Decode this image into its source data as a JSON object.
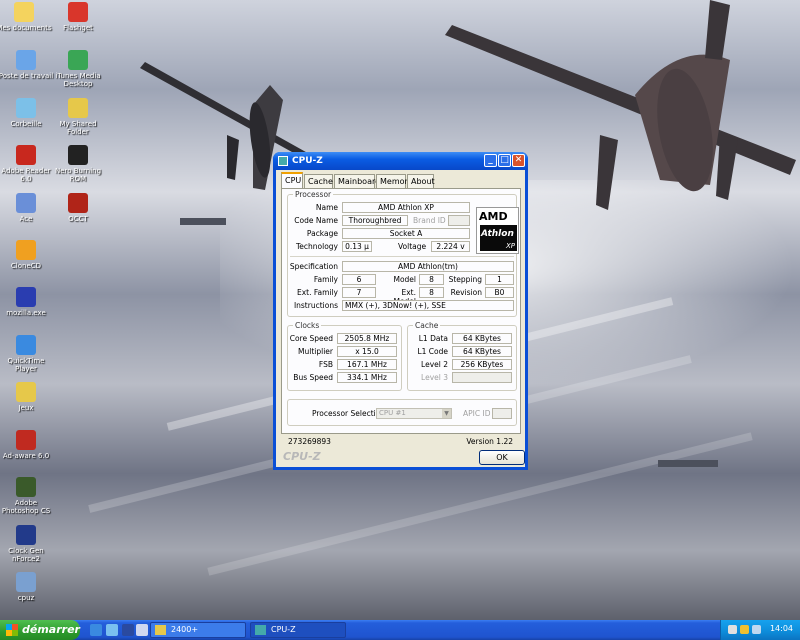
{
  "desktop": {
    "icons": [
      {
        "label": "Mes documents",
        "color": "#f4d35e"
      },
      {
        "label": "Flashget",
        "color": "#d9362b"
      },
      {
        "label": "Poste de travail",
        "color": "#6aa5e8"
      },
      {
        "label": "iTunes Media Desktop",
        "color": "#3aa655"
      },
      {
        "label": "Corbeille",
        "color": "#7cc0e8"
      },
      {
        "label": "My Shared Folder",
        "color": "#e6c84a"
      },
      {
        "label": "Adobe Reader 6.0",
        "color": "#c8281e"
      },
      {
        "label": "Nero Burning ROM",
        "color": "#222222"
      },
      {
        "label": "Ace",
        "color": "#6a8fd8"
      },
      {
        "label": "OCCT",
        "color": "#b02418"
      },
      {
        "label": "CloneCD",
        "color": "#f0a020"
      },
      {
        "label": "mozilla.exe",
        "color": "#2a3db0"
      },
      {
        "label": "QuickTime Player",
        "color": "#3a8ae0"
      },
      {
        "label": "Jeux",
        "color": "#e6c84a"
      },
      {
        "label": "Ad-aware 6.0",
        "color": "#c02a20"
      },
      {
        "label": "Adobe Photoshop CS",
        "color": "#3a5a2a"
      },
      {
        "label": "Clock Gen nForce2",
        "color": "#223a8a"
      },
      {
        "label": "cpuz",
        "color": "#7aa0d0"
      }
    ]
  },
  "window": {
    "title": "CPU-Z",
    "icon": "cpuz-app-icon",
    "tabs": [
      "CPU",
      "Cache",
      "Mainboard",
      "Memory",
      "About"
    ],
    "active_tab": "CPU",
    "processor": {
      "group_label": "Processor",
      "name_label": "Name",
      "name_value": "AMD Athlon XP",
      "codename_label": "Code Name",
      "codename_value": "Thoroughbred",
      "brandid_label": "Brand ID",
      "brandid_value": "",
      "package_label": "Package",
      "package_value": "Socket A",
      "technology_label": "Technology",
      "technology_value": "0.13 µ",
      "voltage_label": "Voltage",
      "voltage_value": "2.224 v",
      "logo_text_amd": "AMD",
      "logo_text_athlon": "Athlon",
      "logo_text_xp": "XP"
    },
    "specification": {
      "spec_label": "Specification",
      "spec_value": "AMD Athlon(tm)",
      "family_label": "Family",
      "family_value": "6",
      "model_label": "Model",
      "model_value": "8",
      "stepping_label": "Stepping",
      "stepping_value": "1",
      "extfamily_label": "Ext. Family",
      "extfamily_value": "7",
      "extmodel_label": "Ext. Model",
      "extmodel_value": "8",
      "revision_label": "Revision",
      "revision_value": "B0",
      "instructions_label": "Instructions",
      "instructions_value": "MMX (+), 3DNow! (+), SSE"
    },
    "clocks": {
      "group_label": "Clocks",
      "corespeed_label": "Core Speed",
      "corespeed_value": "2505.8 MHz",
      "multiplier_label": "Multiplier",
      "multiplier_value": "x 15.0",
      "fsb_label": "FSB",
      "fsb_value": "167.1 MHz",
      "busspeed_label": "Bus Speed",
      "busspeed_value": "334.1 MHz"
    },
    "cache": {
      "group_label": "Cache",
      "l1data_label": "L1 Data",
      "l1data_value": "64 KBytes",
      "l1code_label": "L1 Code",
      "l1code_value": "64 KBytes",
      "level2_label": "Level 2",
      "level2_value": "256 KBytes",
      "level3_label": "Level 3",
      "level3_value": ""
    },
    "selection": {
      "processor_selection_label": "Processor Selection",
      "processor_selection_value": "CPU #1",
      "apicid_label": "APIC ID",
      "apicid_value": ""
    },
    "status_id": "273269893",
    "version": "Version 1.22",
    "brand": "CPU-Z",
    "ok_label": "OK"
  },
  "taskbar": {
    "start_label": "démarrer",
    "buttons": [
      {
        "label": "2400+",
        "icon": "folder-icon"
      },
      {
        "label": "CPU-Z",
        "icon": "cpuz-app-icon"
      }
    ],
    "clock": "14:04",
    "colors": {
      "start_green": "#2d9a2d",
      "bar_blue": "#245edb",
      "tray_blue": "#0d8bd9"
    }
  }
}
